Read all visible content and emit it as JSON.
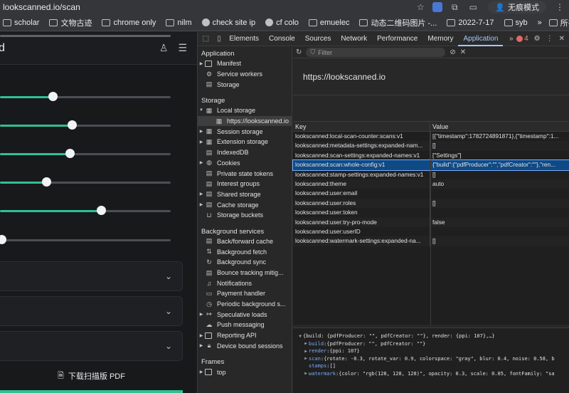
{
  "browser": {
    "url": "lookscanned.io/scan",
    "incognito_label": "无痕模式",
    "bookmarks": [
      "scholar",
      "文物古迹",
      "chrome only",
      "nilm",
      "check site ip",
      "cf colo",
      "emuelec",
      "动态二维码图片 -...",
      "2022-7-17",
      "syb"
    ],
    "bookmarks_more": "»",
    "all_bookmarks": "所有书签"
  },
  "page": {
    "logo_letter": "d",
    "sliders": [
      {
        "value": 0.31
      },
      {
        "value": 0.42
      },
      {
        "value": 0.41
      },
      {
        "value": 0.27
      },
      {
        "value": 0.59
      },
      {
        "value": 0.01
      }
    ],
    "download_label": "下载扫描版 PDF"
  },
  "devtools": {
    "tabs": [
      "Elements",
      "Console",
      "Sources",
      "Network",
      "Performance",
      "Memory",
      "Application"
    ],
    "active_tab": "Application",
    "error_count": "4",
    "sidebar": {
      "application_header": "Application",
      "application_items": [
        "Manifest",
        "Service workers",
        "Storage"
      ],
      "storage_header": "Storage",
      "storage_items": [
        "Local storage",
        "https://lookscanned.io",
        "Session storage",
        "Extension storage",
        "IndexedDB",
        "Cookies",
        "Private state tokens",
        "Interest groups",
        "Shared storage",
        "Cache storage",
        "Storage buckets"
      ],
      "background_header": "Background services",
      "background_items": [
        "Back/forward cache",
        "Background fetch",
        "Background sync",
        "Bounce tracking mitig...",
        "Notifications",
        "Payment handler",
        "Periodic background s...",
        "Speculative loads",
        "Push messaging",
        "Reporting API",
        "Device bound sessions"
      ],
      "frames_header": "Frames",
      "frames_items": [
        "top"
      ]
    },
    "filter_placeholder": "Filter",
    "origin": "https://lookscanned.io",
    "table": {
      "headers": [
        "Key",
        "Value"
      ],
      "rows": [
        [
          "lookscanned:local-scan-counter:scans:v1",
          "[{\"timestamp\":1782724891871},{\"timestamp\":1..."
        ],
        [
          "lookscanned:metadata-settings:expanded-nam...",
          "[]"
        ],
        [
          "lookscanned:scan-settings:expanded-names:v1",
          "[\"Settings\"]"
        ],
        [
          "lookscanned:scan:whole-config:v1",
          "{\"build\":{\"pdfProducer\":\"\",\"pdfCreator\":\"\"},\"ren..."
        ],
        [
          "lookscanned:stamp-settings:expanded-names:v1",
          "[]"
        ],
        [
          "lookscanned:theme",
          "auto"
        ],
        [
          "lookscanned:user:email",
          ""
        ],
        [
          "lookscanned:user:roles",
          "[]"
        ],
        [
          "lookscanned:user:token",
          ""
        ],
        [
          "lookscanned:user:try-pro-mode",
          "false"
        ],
        [
          "lookscanned:user:userID",
          ""
        ],
        [
          "lookscanned:watermark-settings:expanded-na...",
          "[]"
        ]
      ]
    },
    "preview": {
      "line0": "{build: {pdfProducer: \"\", pdfCreator: \"\"}, render: {ppi: 107},…}",
      "build_key": "build",
      "build_val": "{pdfProducer: \"\", pdfCreator: \"\"}",
      "render_key": "render",
      "render_val": "{ppi: 107}",
      "scan_key": "scan",
      "scan_val": "{rotate: -0.3, rotate_var: 0.9, colorspace: \"gray\", blur: 0.4, noise: 0.58, b",
      "stamps_key": "stamps",
      "stamps_val": "[]",
      "watermark_key": "watermark",
      "watermark_val": "{color: \"rgb(128, 128, 128)\", opacity: 0.3, scale: 0.05, fontFamily: \"sa"
    }
  }
}
